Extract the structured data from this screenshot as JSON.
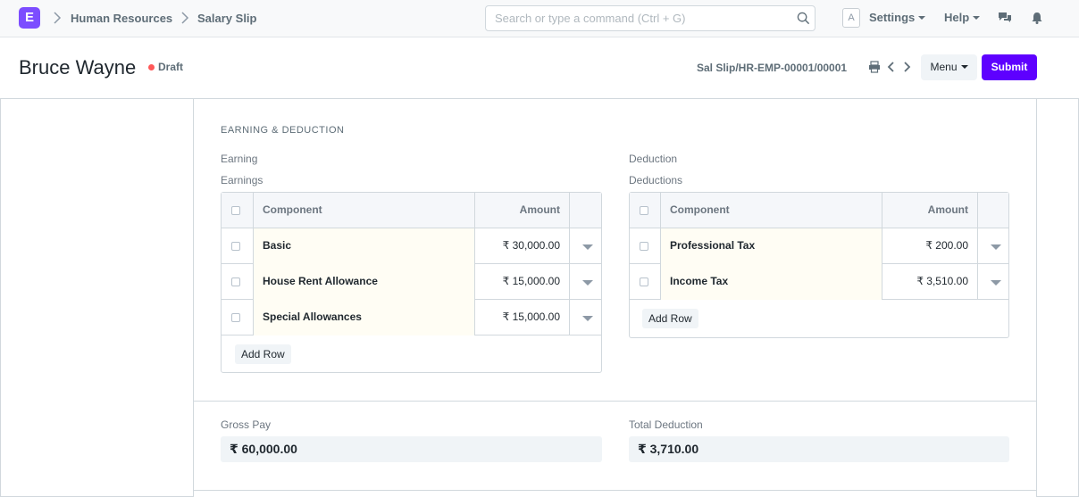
{
  "navbar": {
    "logo": "E",
    "breadcrumbs": [
      "Human Resources",
      "Salary Slip"
    ],
    "search_placeholder": "Search or type a command (Ctrl + G)",
    "avatar": "A",
    "settings": "Settings",
    "help": "Help"
  },
  "page": {
    "title": "Bruce Wayne",
    "status": "Draft",
    "doc_id": "Sal Slip/HR-EMP-00001/00001",
    "menu": "Menu",
    "submit": "Submit"
  },
  "section": {
    "heading": "EARNING & DEDUCTION",
    "earning": {
      "label": "Earning",
      "table_label": "Earnings",
      "columns": [
        "Component",
        "Amount"
      ],
      "rows": [
        {
          "component": "Basic",
          "amount": "₹ 30,000.00"
        },
        {
          "component": "House Rent Allowance",
          "amount": "₹ 15,000.00"
        },
        {
          "component": "Special Allowances",
          "amount": "₹ 15,000.00"
        }
      ],
      "add_row": "Add Row"
    },
    "deduction": {
      "label": "Deduction",
      "table_label": "Deductions",
      "columns": [
        "Component",
        "Amount"
      ],
      "rows": [
        {
          "component": "Professional Tax",
          "amount": "₹ 200.00"
        },
        {
          "component": "Income Tax",
          "amount": "₹ 3,510.00"
        }
      ],
      "add_row": "Add Row"
    }
  },
  "totals": {
    "gross_label": "Gross Pay",
    "gross_value": "₹ 60,000.00",
    "deduction_label": "Total Deduction",
    "deduction_value": "₹ 3,710.00"
  },
  "colors": {
    "accent": "#5e00ff",
    "logo": "#7c4dff",
    "draft_dot": "#ff5858"
  }
}
